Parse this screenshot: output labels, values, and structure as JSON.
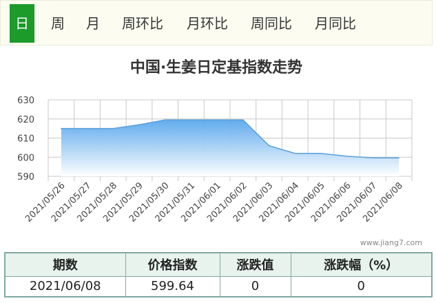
{
  "tabs": [
    {
      "label": "日",
      "active": true
    },
    {
      "label": "周",
      "active": false
    },
    {
      "label": "月",
      "active": false
    },
    {
      "label": "周环比",
      "active": false
    },
    {
      "label": "月环比",
      "active": false
    },
    {
      "label": "周同比",
      "active": false
    },
    {
      "label": "月同比",
      "active": false
    }
  ],
  "colors": {
    "tab_active_bg": "#1c9a2a",
    "area_top": "#5aa8ec",
    "area_bottom": "#ffffff",
    "line": "#5a9fdc",
    "table_border": "#7fa9a0",
    "table_header_bg": "#e8f3ee"
  },
  "watermark": "www.jiang7.com",
  "chart_data": {
    "type": "area",
    "title": "中国·生姜日定基指数走势",
    "xlabel": "",
    "ylabel": "",
    "x": [
      "2021/05/26",
      "2021/05/27",
      "2021/05/28",
      "2021/05/29",
      "2021/05/30",
      "2021/05/31",
      "2021/06/01",
      "2021/06/02",
      "2021/06/03",
      "2021/06/04",
      "2021/06/05",
      "2021/06/06",
      "2021/06/07",
      "2021/06/08"
    ],
    "series": [
      {
        "values": [
          615,
          615,
          615,
          617,
          619.5,
          619.5,
          619.5,
          619.5,
          606,
          602,
          602,
          600.5,
          599.64,
          599.64
        ]
      }
    ],
    "yticks": [
      590,
      600,
      610,
      620,
      630
    ],
    "ylim": [
      590,
      630
    ],
    "grid": true
  },
  "table": {
    "headers": [
      "期数",
      "价格指数",
      "涨跌值",
      "涨跌幅（%）"
    ],
    "rows": [
      [
        "2021/06/08",
        "599.64",
        "0",
        "0"
      ]
    ]
  }
}
